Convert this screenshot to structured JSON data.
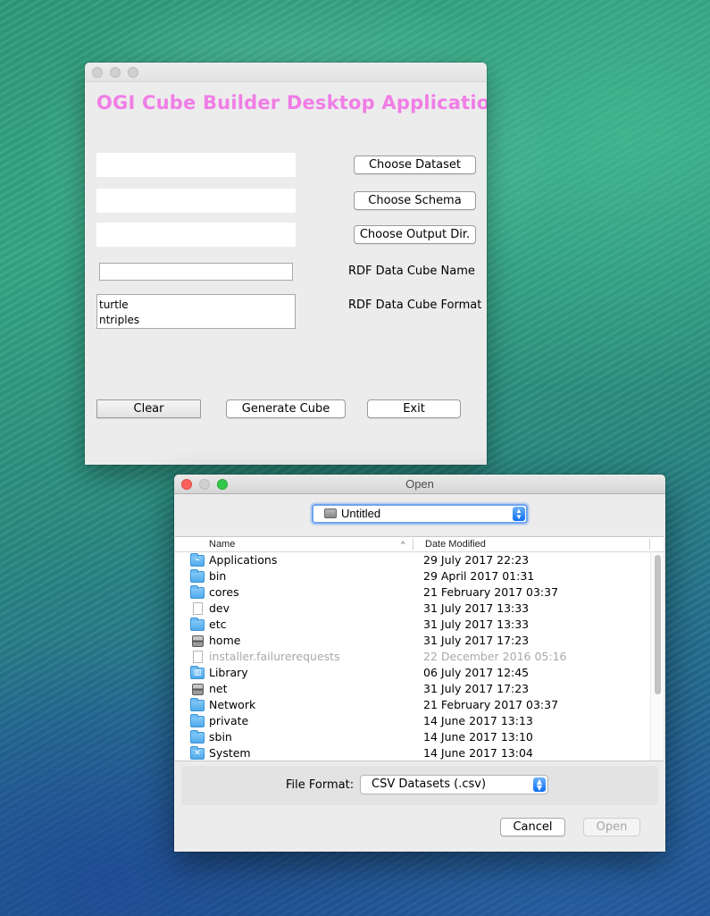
{
  "app": {
    "title": "OGI Cube Builder Desktop Application",
    "buttons": {
      "choose_dataset": "Choose Dataset",
      "choose_schema": "Choose Schema",
      "choose_output": "Choose Output Dir.",
      "clear": "Clear",
      "generate": "Generate Cube",
      "exit": "Exit"
    },
    "labels": {
      "cube_name": "RDF Data Cube Name",
      "cube_format": "RDF Data Cube Format"
    },
    "cube_name_value": "",
    "formats": [
      "turtle",
      "ntriples"
    ]
  },
  "dialog": {
    "title": "Open",
    "location": "Untitled",
    "columns": {
      "name": "Name",
      "date": "Date Modified",
      "sort_indicator": "^"
    },
    "files": [
      {
        "name": "Applications",
        "date": "29 July 2017 22:23",
        "icon": "applications-folder-icon",
        "enabled": true
      },
      {
        "name": "bin",
        "date": "29 April 2017 01:31",
        "icon": "folder-icon",
        "enabled": true
      },
      {
        "name": "cores",
        "date": "21 February 2017 03:37",
        "icon": "folder-icon",
        "enabled": true
      },
      {
        "name": "dev",
        "date": "31 July 2017 13:33",
        "icon": "document-icon",
        "enabled": true
      },
      {
        "name": "etc",
        "date": "31 July 2017 13:33",
        "icon": "folder-icon",
        "enabled": true
      },
      {
        "name": "home",
        "date": "31 July 2017 17:23",
        "icon": "network-disk-icon",
        "enabled": true
      },
      {
        "name": "installer.failurerequests",
        "date": "22 December 2016 05:16",
        "icon": "document-icon",
        "enabled": false
      },
      {
        "name": "Library",
        "date": "06 July 2017 12:45",
        "icon": "library-folder-icon",
        "enabled": true
      },
      {
        "name": "net",
        "date": "31 July 2017 17:23",
        "icon": "network-disk-icon",
        "enabled": true
      },
      {
        "name": "Network",
        "date": "21 February 2017 03:37",
        "icon": "folder-icon",
        "enabled": true
      },
      {
        "name": "private",
        "date": "14 June 2017 13:13",
        "icon": "folder-icon",
        "enabled": true
      },
      {
        "name": "sbin",
        "date": "14 June 2017 13:10",
        "icon": "folder-icon",
        "enabled": true
      },
      {
        "name": "System",
        "date": "14 June 2017 13:04",
        "icon": "system-folder-icon",
        "enabled": true
      }
    ],
    "file_format_label": "File Format:",
    "file_format_value": "CSV Datasets (.csv)",
    "cancel_label": "Cancel",
    "open_label": "Open"
  }
}
